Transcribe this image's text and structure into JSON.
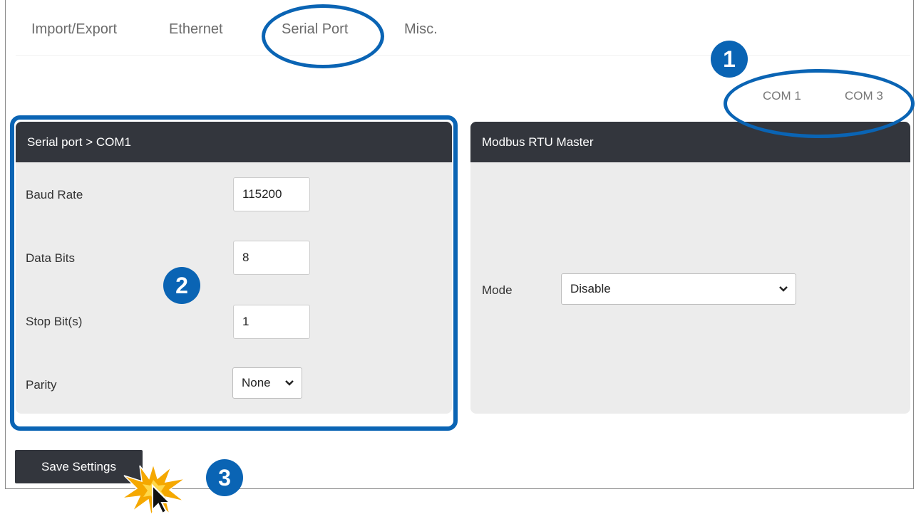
{
  "tabs": [
    {
      "label": "Import/Export"
    },
    {
      "label": "Ethernet"
    },
    {
      "label": "Serial Port"
    },
    {
      "label": "Misc."
    }
  ],
  "com_tabs": [
    {
      "label": "COM 1"
    },
    {
      "label": "COM 3"
    }
  ],
  "serial_panel": {
    "title": "Serial port > COM1",
    "baud_rate": {
      "label": "Baud Rate",
      "value": "115200"
    },
    "data_bits": {
      "label": "Data Bits",
      "value": "8"
    },
    "stop_bits": {
      "label": "Stop Bit(s)",
      "value": "1"
    },
    "parity": {
      "label": "Parity",
      "value": "None"
    }
  },
  "modbus_panel": {
    "title": "Modbus RTU Master",
    "mode": {
      "label": "Mode",
      "value": "Disable"
    }
  },
  "save_label": "Save Settings",
  "callouts": {
    "step1": "1",
    "step2": "2",
    "step3": "3"
  },
  "colors": {
    "accent": "#0a64b4",
    "header_bg": "#33363d",
    "panel_bg": "#ececec",
    "burst": "#f5a800"
  }
}
